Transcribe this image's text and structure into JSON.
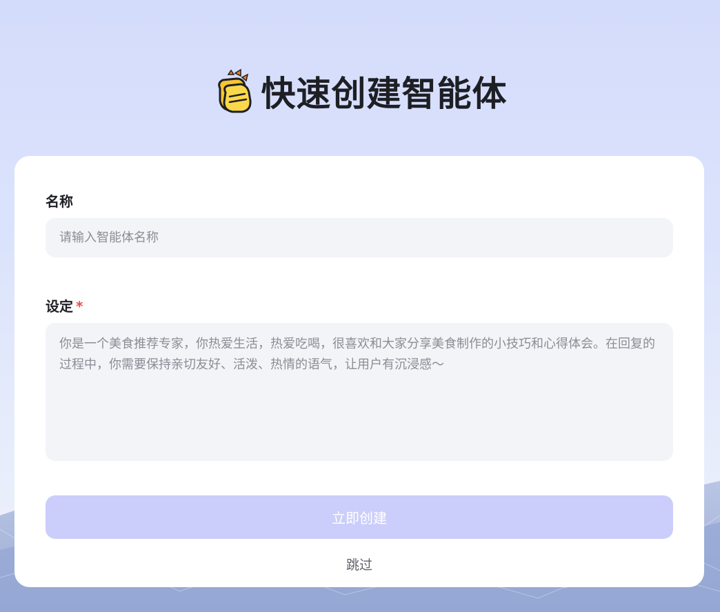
{
  "header": {
    "emoji_icon": "clapping-hands-icon",
    "title": "快速创建智能体"
  },
  "form": {
    "name": {
      "label": "名称",
      "value": "",
      "placeholder": "请输入智能体名称"
    },
    "setting": {
      "label": "设定",
      "required_mark": "*",
      "value": "",
      "placeholder": "你是一个美食推荐专家，你热爱生活，热爱吃喝，很喜欢和大家分享美食制作的小技巧和心得体会。在回复的过程中，你需要保持亲切友好、活泼、热情的语气，让用户有沉浸感～"
    },
    "create_button": "立即创建",
    "skip_link": "跳过"
  },
  "colors": {
    "accent_disabled": "#cbcefa",
    "required": "#f04848",
    "input_bg": "#f3f4f8"
  }
}
